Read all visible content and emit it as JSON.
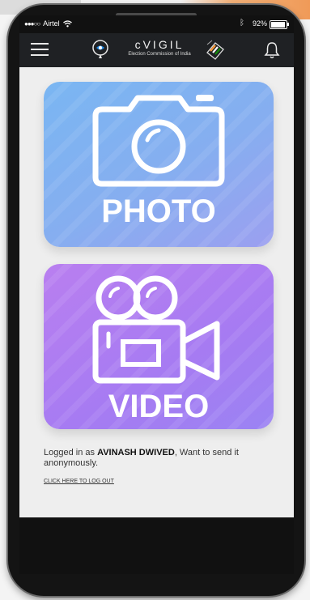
{
  "status_bar": {
    "carrier": "Airtel",
    "battery_percent": "92%",
    "battery_level": 0.92
  },
  "app_bar": {
    "title": "cVIGIL",
    "subtitle": "Election Commission of India"
  },
  "cards": {
    "photo_label": "PHOTO",
    "video_label": "VIDEO"
  },
  "footer": {
    "prefix": "Logged in as ",
    "user_name": "AVINASH DWIVED",
    "suffix": ", Want to send it anonymously.",
    "logout_link": "CLICK HERE TO LOG OUT"
  },
  "colors": {
    "photo_card": "#86aef0",
    "video_card": "#b07ff2",
    "app_bar": "#1f2124"
  },
  "icons": {
    "menu": "hamburger-icon",
    "logo": "location-pin-eye-icon",
    "eci": "ballot-box-icon",
    "notifications": "bell-icon",
    "photo": "camera-icon",
    "video": "video-camera-icon"
  }
}
